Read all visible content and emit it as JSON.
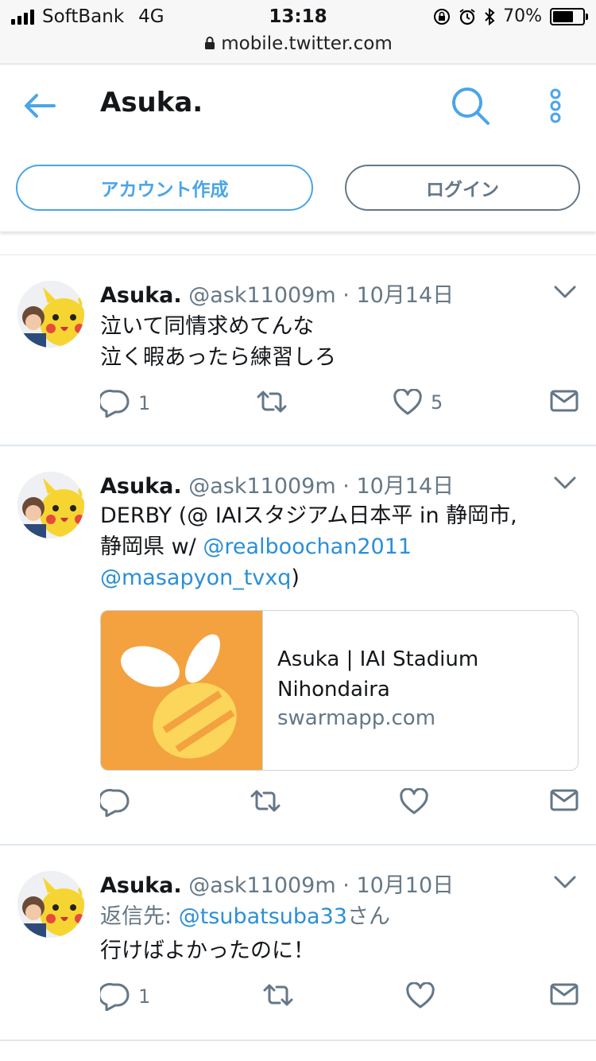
{
  "status_bar": {
    "carrier": "SoftBank",
    "network": "4G",
    "time": "13:18",
    "battery": "70%",
    "battery_level": 0.7,
    "url": "mobile.twitter.com"
  },
  "header": {
    "title": "Asuka.",
    "signup_label": "アカウント作成",
    "login_label": "ログイン"
  },
  "tweets": [
    {
      "name": "Asuka.",
      "handle": "@ask11009m",
      "separator": "·",
      "date": "10月14日",
      "lines": [
        "泣いて同情求めてんな",
        "泣く暇あったら練習しろ"
      ],
      "reply_count": "1",
      "like_count": "5"
    },
    {
      "name": "Asuka.",
      "handle": "@ask11009m",
      "separator": "·",
      "date": "10月14日",
      "text_line1": "DERBY (@ IAIスタジアム日本平 in 静岡市,",
      "text_line2_prefix": "静岡県 w/ ",
      "mention1": "@realboochan2011",
      "mention2": "@masapyon_tvxq",
      "text_close": ")",
      "card": {
        "title": "Asuka | IAI Stadium Nihondaira",
        "domain": "swarmapp.com",
        "image_color": "#f3a23f"
      }
    },
    {
      "name": "Asuka.",
      "handle": "@ask11009m",
      "separator": "·",
      "date": "10月10日",
      "reply_prefix": "返信先: ",
      "reply_to": "@tsubatsuba33",
      "reply_suffix": "さん",
      "text": "行けばよかったのに！",
      "reply_count": "1"
    }
  ],
  "icons": {
    "back": "arrow-left-icon",
    "search": "search-icon",
    "more": "more-vertical-icon",
    "caret": "chevron-down-icon",
    "reply": "reply-icon",
    "retweet": "retweet-icon",
    "like": "heart-icon",
    "dm": "envelope-icon"
  },
  "colors": {
    "accent": "#4aa5e8",
    "link": "#2b8fd8",
    "secondary_text": "#657786"
  }
}
